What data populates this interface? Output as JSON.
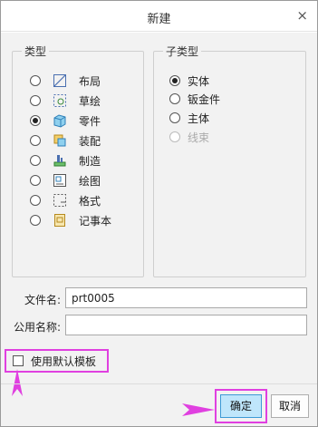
{
  "dialog": {
    "title": "新建",
    "close_glyph": "×"
  },
  "types": {
    "legend": "类型",
    "options": [
      {
        "label": "布局",
        "icon": "layout-icon",
        "checked": false
      },
      {
        "label": "草绘",
        "icon": "sketch-icon",
        "checked": false
      },
      {
        "label": "零件",
        "icon": "part-icon",
        "checked": true
      },
      {
        "label": "装配",
        "icon": "assembly-icon",
        "checked": false
      },
      {
        "label": "制造",
        "icon": "manufacturing-icon",
        "checked": false
      },
      {
        "label": "绘图",
        "icon": "drawing-icon",
        "checked": false
      },
      {
        "label": "格式",
        "icon": "format-icon",
        "checked": false
      },
      {
        "label": "记事本",
        "icon": "notebook-icon",
        "checked": false
      }
    ]
  },
  "subtypes": {
    "legend": "子类型",
    "options": [
      {
        "label": "实体",
        "checked": true,
        "disabled": false
      },
      {
        "label": "钣金件",
        "checked": false,
        "disabled": false
      },
      {
        "label": "主体",
        "checked": false,
        "disabled": false
      },
      {
        "label": "线束",
        "checked": false,
        "disabled": true
      }
    ]
  },
  "fields": {
    "filename_label": "文件名:",
    "filename_value": "prt0005",
    "common_name_label": "公用名称:",
    "common_name_value": ""
  },
  "options": {
    "use_default_template_label": "使用默认模板",
    "use_default_template_checked": false
  },
  "buttons": {
    "ok": "确定",
    "cancel": "取消"
  },
  "colors": {
    "highlight": "#e040e0",
    "ok_button_bg": "#bfe6fb",
    "ok_button_border": "#3c9ad6"
  }
}
